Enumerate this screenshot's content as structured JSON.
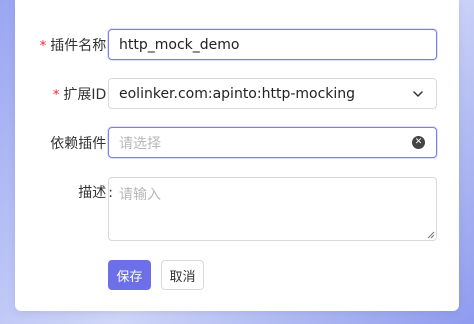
{
  "form": {
    "plugin_name": {
      "required_mark": "*",
      "label": "插件名称",
      "colon": ":",
      "value": "http_mock_demo"
    },
    "extension_id": {
      "required_mark": "*",
      "label": "扩展ID",
      "colon": ":",
      "value": "eolinker.com:apinto:http-mocking"
    },
    "dependency": {
      "label": "依赖插件",
      "colon": ":",
      "placeholder": "请选择"
    },
    "description": {
      "label": "描述",
      "colon": ":",
      "placeholder": "请输入"
    }
  },
  "actions": {
    "save_label": "保存",
    "cancel_label": "取消"
  },
  "colors": {
    "primary": "#6d6fe8",
    "required": "#f5222d",
    "focus_border": "#7b7fe6"
  },
  "icons": {
    "select_arrow": "chevron-down-icon",
    "clear": "clear-circle-icon",
    "resize": "resize-handle-icon"
  }
}
